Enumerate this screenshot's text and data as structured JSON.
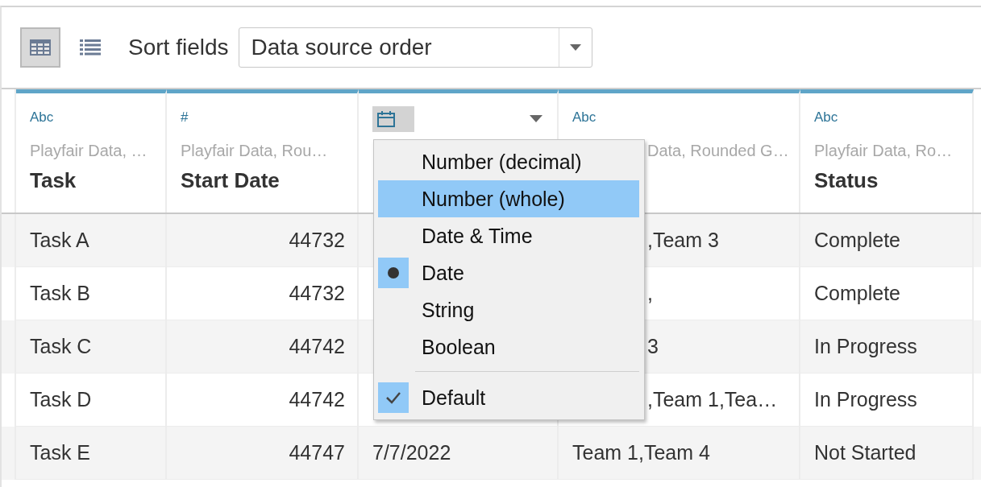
{
  "toolbar": {
    "views": [
      {
        "kind": "grid",
        "selected": true
      },
      {
        "kind": "list",
        "selected": false
      }
    ],
    "sort_label": "Sort fields",
    "sort_value": "Data source order"
  },
  "columns": [
    {
      "kind": "text",
      "type_label": "Abc",
      "source": "Playfair Data, …",
      "name": "Task"
    },
    {
      "kind": "number",
      "type_label": "#",
      "source": "Playfair Data, Rou…",
      "name": "Start Date"
    },
    {
      "kind": "date",
      "menu_open": true
    },
    {
      "kind": "text",
      "type_label": "Abc",
      "source": "Data, Rounded G…"
    },
    {
      "kind": "text",
      "type_label": "Abc",
      "source": "Playfair Data, Ro…",
      "name": "Status"
    }
  ],
  "rows": [
    [
      "Task A",
      "44732",
      "",
      ",Team 3",
      "Complete"
    ],
    [
      "Task B",
      "44732",
      "",
      ",",
      "Complete"
    ],
    [
      "Task C",
      "44742",
      "",
      "3",
      "In Progress"
    ],
    [
      "Task D",
      "44742",
      "",
      ",Team 1,Tea…",
      "In Progress"
    ],
    [
      "Task E",
      "44747",
      "7/7/2022",
      "Team 1,Team 4",
      "Not Started"
    ]
  ],
  "type_menu": {
    "types": [
      {
        "label": "Number (decimal)",
        "hovered": false,
        "checked": false
      },
      {
        "label": "Number (whole)",
        "hovered": true,
        "checked": false
      },
      {
        "label": "Date & Time",
        "hovered": false,
        "checked": false
      },
      {
        "label": "Date",
        "hovered": false,
        "checked": true
      },
      {
        "label": "String",
        "hovered": false,
        "checked": false
      },
      {
        "label": "Boolean",
        "hovered": false,
        "checked": false
      }
    ],
    "options": [
      {
        "label": "Default",
        "hovered": false,
        "checked": true
      }
    ]
  }
}
